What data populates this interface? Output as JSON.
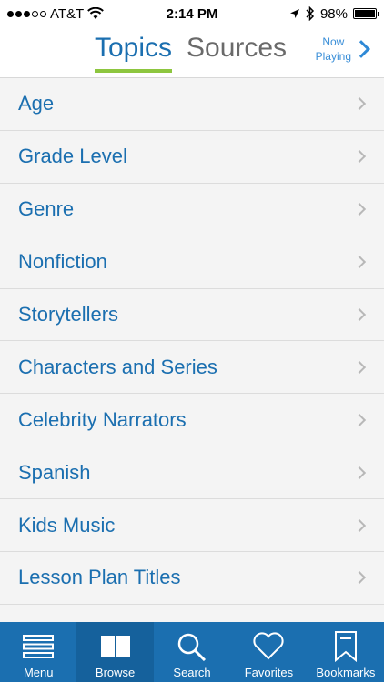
{
  "status": {
    "carrier": "AT&T",
    "time": "2:14 PM",
    "battery": "98%",
    "battery_level": 0.98,
    "signal_bars_filled": 3,
    "signal_bars_total": 5
  },
  "header": {
    "tabs": [
      {
        "label": "Topics",
        "active": true
      },
      {
        "label": "Sources",
        "active": false
      }
    ],
    "now_playing_line1": "Now",
    "now_playing_line2": "Playing"
  },
  "topics": [
    {
      "label": "Age"
    },
    {
      "label": "Grade Level"
    },
    {
      "label": "Genre"
    },
    {
      "label": "Nonfiction"
    },
    {
      "label": "Storytellers"
    },
    {
      "label": "Characters and Series"
    },
    {
      "label": "Celebrity Narrators"
    },
    {
      "label": "Spanish"
    },
    {
      "label": "Kids Music"
    },
    {
      "label": "Lesson Plan Titles"
    }
  ],
  "tab_bar": {
    "items": [
      {
        "label": "Menu",
        "icon": "menu-icon",
        "active": false
      },
      {
        "label": "Browse",
        "icon": "book-icon",
        "active": true
      },
      {
        "label": "Search",
        "icon": "search-icon",
        "active": false
      },
      {
        "label": "Favorites",
        "icon": "heart-icon",
        "active": false
      },
      {
        "label": "Bookmarks",
        "icon": "bookmark-icon",
        "active": false
      }
    ]
  },
  "colors": {
    "accent_blue": "#1b6fb0",
    "tab_underline_green": "#8dc63f",
    "tab_bar_bg": "#1b6fb0"
  }
}
